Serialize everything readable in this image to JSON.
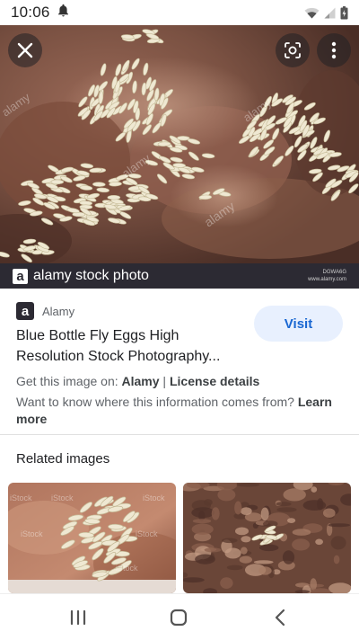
{
  "status_bar": {
    "time": "10:06",
    "icons": [
      "notification-bell-icon",
      "wifi-icon",
      "signal-icon",
      "battery-icon"
    ]
  },
  "viewer": {
    "image_subject": "blue bottle fly eggs on meat",
    "watermark": "alamy",
    "buttons": [
      "close-icon",
      "lens-icon",
      "more-vert-icon"
    ]
  },
  "banner": {
    "logo_letter": "a",
    "text": "alamy stock photo",
    "ref_code": "DGWA6G",
    "ref_site": "www.alamy.com"
  },
  "result": {
    "source_logo_letter": "a",
    "source": "Alamy",
    "visit_label": "Visit",
    "title_line1": "Blue Bottle Fly Eggs High",
    "title_line2": "Resolution Stock Photography...",
    "get_prefix": "Get this image on: ",
    "get_source": "Alamy",
    "get_separator": " | ",
    "license": "License details",
    "want_prefix": "Want to know where this information comes from? ",
    "learn_more": "Learn more"
  },
  "related": {
    "heading": "Related images",
    "thumb_watermark": "iStock"
  },
  "nav": {
    "icons": [
      "recents-icon",
      "home-icon",
      "back-icon"
    ]
  },
  "colors": {
    "visit_bg": "#e8f0fe",
    "visit_text": "#1967d2",
    "banner_bg": "#2c2a33"
  }
}
